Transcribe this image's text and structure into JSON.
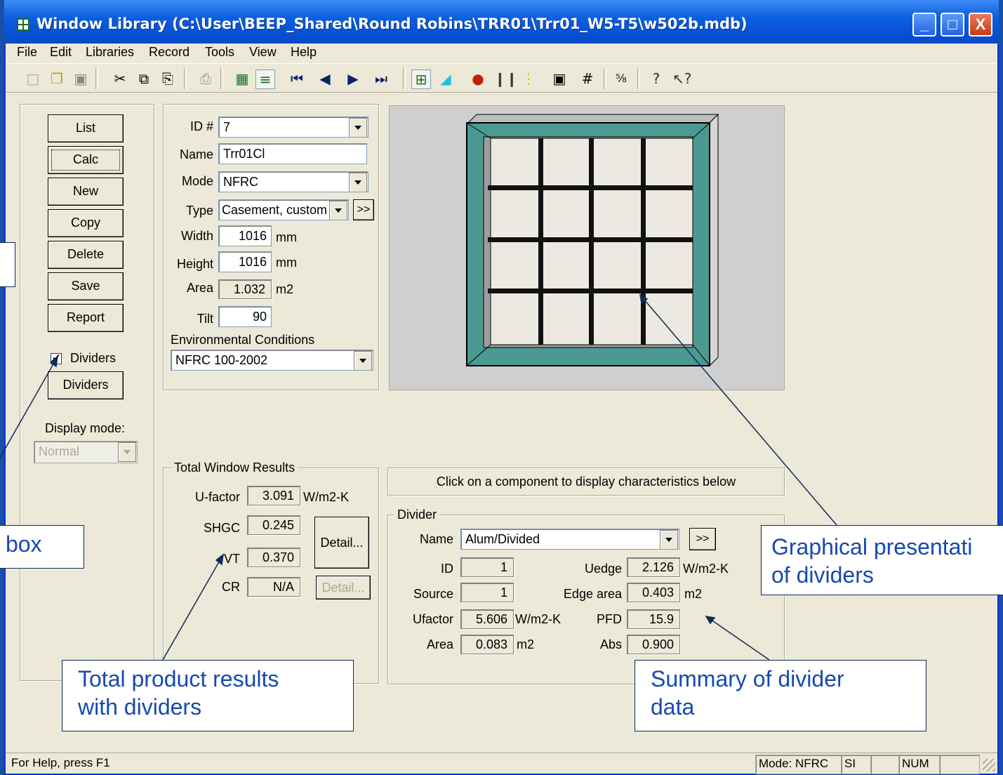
{
  "window": {
    "title": "Window Library (C:\\User\\BEEP_Shared\\Round Robins\\TRR01\\Trr01_W5-T5\\w502b.mdb)",
    "controls": [
      "_",
      "□",
      "X"
    ]
  },
  "menu": [
    "File",
    "Edit",
    "Libraries",
    "Record",
    "Tools",
    "View",
    "Help"
  ],
  "toolbar": {
    "icons": [
      "new-icon",
      "open-icon",
      "save-icon",
      "cut-icon",
      "copy-icon",
      "paste-icon",
      "print-icon",
      "grid-view-icon",
      "list-view-icon",
      "first-record-icon",
      "prev-record-icon",
      "next-record-icon",
      "last-record-icon",
      "window-icon",
      "glazing-icon",
      "gas-icon",
      "frame-icon",
      "divider-icon",
      "shading-icon",
      "hash-icon",
      "fraction-icon",
      "help-icon",
      "context-help-icon"
    ]
  },
  "left_buttons": {
    "list": "List",
    "calc": "Calc",
    "new": "New",
    "copy": "Copy",
    "delete": "Delete",
    "save": "Save",
    "report": "Report",
    "dividers_check": "Dividers",
    "dividers_button": "Dividers",
    "display_mode_label": "Display mode:",
    "display_mode_value": "Normal"
  },
  "props": {
    "id_label": "ID #",
    "id_value": "7",
    "name_label": "Name",
    "name_value": "Trr01Cl",
    "mode_label": "Mode",
    "mode_value": "NFRC",
    "type_label": "Type",
    "type_value": "Casement, custom",
    "type_more": ">>",
    "width_label": "Width",
    "width_value": "1016",
    "width_unit": "mm",
    "height_label": "Height",
    "height_value": "1016",
    "height_unit": "mm",
    "area_label": "Area",
    "area_value": "1.032",
    "area_unit": "m2",
    "tilt_label": "Tilt",
    "tilt_value": "90",
    "env_label": "Environmental Conditions",
    "env_value": "NFRC 100-2002"
  },
  "results": {
    "title": "Total Window Results",
    "ufactor_label": "U-factor",
    "ufactor_value": "3.091",
    "ufactor_unit": "W/m2-K",
    "shgc_label": "SHGC",
    "shgc_value": "0.245",
    "vt_label": "VT",
    "vt_value": "0.370",
    "cr_label": "CR",
    "cr_value": "N/A",
    "detail1": "Detail...",
    "detail2": "Detail..."
  },
  "component_hint": "Click on a component to display characteristics below",
  "divider": {
    "title": "Divider",
    "name_label": "Name",
    "name_value": "Alum/Divided",
    "more": ">>",
    "id_label": "ID",
    "id_value": "1",
    "source_label": "Source",
    "source_value": "1",
    "ufactor_label": "Ufactor",
    "ufactor_value": "5.606",
    "ufactor_unit": "W/m2-K",
    "area_label": "Area",
    "area_value": "0.083",
    "area_unit": "m2",
    "uedge_label": "Uedge",
    "uedge_value": "2.126",
    "uedge_unit": "W/m2-K",
    "edge_area_label": "Edge area",
    "edge_area_value": "0.403",
    "edge_area_unit": "m2",
    "pfd_label": "PFD",
    "pfd_value": "15.9",
    "abs_label": "Abs",
    "abs_value": "0.900"
  },
  "callouts": {
    "box": "box",
    "graphical": "Graphical presentation of dividers",
    "graphical_line1": "Graphical presentati",
    "graphical_line2": "of dividers",
    "total_line1": "Total product results",
    "total_line2": "with dividers",
    "summary_line1": "Summary of divider",
    "summary_line2": "data"
  },
  "status": {
    "help": "For Help, press F1",
    "mode": "Mode: NFRC",
    "units": "SI",
    "num": "NUM"
  },
  "colors": {
    "frame": "#4a9a92",
    "glass": "#ebe9e1",
    "callout_text": "#1749b0",
    "titlebar": "#0a5ee0"
  }
}
